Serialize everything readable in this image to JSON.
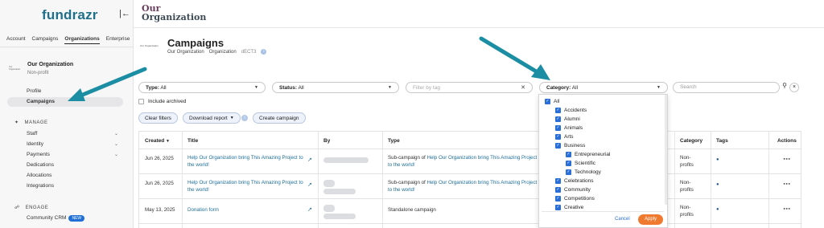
{
  "sidebar": {
    "logo": "fundrazr",
    "collapse_icon": "collapse-left-icon",
    "nav_tabs": [
      "Account",
      "Campaigns",
      "Organizations",
      "Enterprise"
    ],
    "active_tab": "Organizations",
    "org_name": "Our Organization",
    "org_type": "Non-profit",
    "org_thumb_text": "Our Organization",
    "items": [
      "Profile",
      "Campaigns"
    ],
    "active_item": "Campaigns",
    "manage_head": "MANAGE",
    "manage_items": [
      "Staff",
      "Identity",
      "Payments",
      "Dedications",
      "Allocations",
      "Integrations"
    ],
    "engage_head": "ENGAGE",
    "engage_items": [
      "Community CRM"
    ],
    "new_badge": "NEW"
  },
  "header": {
    "org_line1": "Our",
    "org_line2": "Organization"
  },
  "page": {
    "title": "Campaigns",
    "crumb_org": "Our Organization",
    "crumb_type": "Organization",
    "crumb_code": "dECT3",
    "thumb_text": "Our Organization"
  },
  "filters": {
    "type_label": "Type:",
    "type_value": "All",
    "status_label": "Status:",
    "status_value": "All",
    "tag_placeholder": "Filter by tag",
    "category_label": "Category:",
    "category_value": "All",
    "search_placeholder": "Search",
    "include_archived": "Include archived",
    "clear_filters": "Clear filters",
    "download_report": "Download report",
    "create_campaign": "Create campaign"
  },
  "table": {
    "headers": {
      "created": "Created",
      "title": "Title",
      "by": "By",
      "type": "Type",
      "category": "Category",
      "tags": "Tags",
      "actions": "Actions"
    },
    "rows": [
      {
        "created": "Jun 26, 2025",
        "title": "Help Our Organization bring This Amazing Project to the world!",
        "type_prefix": "Sub-campaign of ",
        "type_link": "Help Our Organization bring This Amazing Project to the world!",
        "category": "Non-profits"
      },
      {
        "created": "Jun 26, 2025",
        "title": "Help Our Organization bring This Amazing Project to the world!",
        "type_prefix": "Sub-campaign of ",
        "type_link": "Help Our Organization bring This Amazing Project to the world!",
        "category": "Non-profits"
      },
      {
        "created": "May 13, 2025",
        "title": "Donation form",
        "type_prefix": "Standalone campaign",
        "type_link": "",
        "category": "Non-profits"
      }
    ]
  },
  "category_dropdown": {
    "all": "All",
    "items": [
      "Accidents",
      "Alumni",
      "Animals",
      "Arts",
      "Business"
    ],
    "business_children": [
      "Entrepreneurial",
      "Scientific",
      "Technology"
    ],
    "more": [
      "Celebrations",
      "Community",
      "Competitions",
      "Creative"
    ],
    "cancel": "Cancel",
    "apply": "Apply"
  },
  "colors": {
    "brand": "#1f6f8b",
    "checkbox": "#2a6fd8",
    "apply": "#ef7a2f",
    "arrow": "#1c8ea3"
  }
}
